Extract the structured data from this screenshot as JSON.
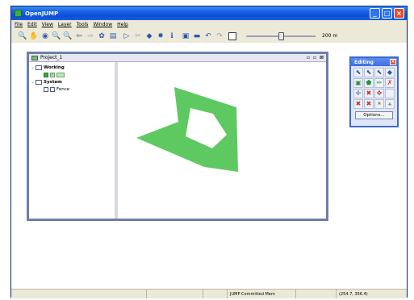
{
  "window": {
    "title": "OpenJUMP",
    "minimize": "_",
    "maximize": "□",
    "close": "×"
  },
  "menu": [
    "File",
    "Edit",
    "View",
    "Layer",
    "Tools",
    "Window",
    "Help"
  ],
  "toolbar": {
    "tools": [
      {
        "name": "zoom-icon",
        "glyph": "🔍"
      },
      {
        "name": "pan-icon",
        "glyph": "✋"
      },
      {
        "name": "zoom-full-icon",
        "glyph": "◉"
      },
      {
        "name": "zoom-selected-icon",
        "glyph": "🔍",
        "dim": true
      },
      {
        "name": "zoom-layer-icon",
        "glyph": "🔍"
      },
      {
        "name": "zoom-previous-icon",
        "glyph": "⇦"
      },
      {
        "name": "zoom-next-icon",
        "glyph": "⇨",
        "dim": true
      },
      {
        "name": "zoom-fence-icon",
        "glyph": "✿"
      },
      {
        "name": "zoom-extent-icon",
        "glyph": "▤"
      },
      {
        "name": "select-icon",
        "glyph": "▷",
        "gap": true
      },
      {
        "name": "cut-icon",
        "glyph": "✂",
        "dim": true
      },
      {
        "name": "box-icon",
        "glyph": "◆"
      },
      {
        "name": "cluster-icon",
        "glyph": "✸"
      },
      {
        "name": "info-icon",
        "glyph": "ℹ"
      },
      {
        "name": "editing-toolbox-icon",
        "glyph": "▣",
        "gap": true
      },
      {
        "name": "highlight-icon",
        "glyph": "▬"
      },
      {
        "name": "undo-icon",
        "glyph": "↶"
      },
      {
        "name": "redo-icon",
        "glyph": "↷",
        "dim": true
      },
      {
        "name": "rectangle-icon",
        "glyph": "",
        "sq": true,
        "gap": true
      }
    ],
    "scale": "200 m",
    "zoom_level": 0.5
  },
  "project": {
    "title": "Project_1",
    "controls": [
      "▫",
      "▫",
      "⊠"
    ],
    "tree": [
      {
        "label": "Working",
        "type": "category",
        "level": 0
      },
      {
        "label": "",
        "type": "layer",
        "level": 1,
        "checked": true
      },
      {
        "label": "System",
        "type": "category",
        "level": 0
      },
      {
        "label": "Fence",
        "type": "layer",
        "level": 1,
        "checked": false
      }
    ]
  },
  "editing": {
    "title": "Editing",
    "close": "×",
    "tools": [
      {
        "name": "select-features-icon",
        "glyph": "⬉"
      },
      {
        "name": "select-parts-icon",
        "glyph": "⬉"
      },
      {
        "name": "select-linestrings-icon",
        "glyph": "⬉"
      },
      {
        "name": "move-features-icon",
        "glyph": "◆"
      },
      {
        "name": "draw-rectangle-icon",
        "glyph": "▣"
      },
      {
        "name": "draw-polygon-icon",
        "glyph": "⬟"
      },
      {
        "name": "draw-linestring-icon",
        "glyph": "✏"
      },
      {
        "name": "draw-point-icon",
        "glyph": "✗"
      },
      {
        "name": "move-vertex-icon",
        "glyph": "✢"
      },
      {
        "name": "insert-vertex-icon",
        "glyph": "✖"
      },
      {
        "name": "delete-vertex-icon",
        "glyph": "✥"
      },
      {
        "name": "snap-icon",
        "glyph": " "
      },
      {
        "name": "split-icon",
        "glyph": "✖"
      },
      {
        "name": "union-icon",
        "glyph": "✖"
      },
      {
        "name": "rotate-icon",
        "glyph": "✶"
      },
      {
        "name": "measure-icon",
        "glyph": "⚹"
      }
    ],
    "options": "Options..."
  },
  "status": {
    "cells": [
      "",
      "",
      "",
      "JUMP Committed Mem",
      "",
      "(254.7, 356.4)"
    ]
  },
  "colors": {
    "polygon_fill": "#5ec960",
    "titlebar": "#1660e8"
  }
}
